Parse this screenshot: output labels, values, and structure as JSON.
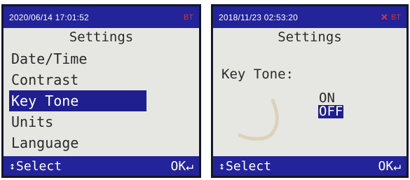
{
  "left_screen": {
    "status": {
      "datetime": "2020/06/14 17:01:52",
      "bt": "BT"
    },
    "title": "Settings",
    "menu": [
      {
        "label": "Date/Time",
        "selected": false
      },
      {
        "label": "Contrast",
        "selected": false
      },
      {
        "label": "Key Tone",
        "selected": true
      },
      {
        "label": "Units",
        "selected": false
      },
      {
        "label": "Language",
        "selected": false
      }
    ],
    "footer": {
      "arrow": "↕",
      "select": "Select",
      "ok": "OK↵"
    }
  },
  "right_screen": {
    "status": {
      "datetime": "2018/11/23 02:53:20",
      "mute": "✕",
      "bt": "BT"
    },
    "title": "Settings",
    "label": "Key Tone:",
    "options": {
      "on": "ON",
      "off": "OFF",
      "selected": "off"
    },
    "footer": {
      "arrow": "↕",
      "select": "Select",
      "ok": "OK↵"
    }
  },
  "colors": {
    "bar": "#23239a",
    "highlight": "#1f1f8f",
    "screen": "#e6e7e2",
    "alert": "#c8373a"
  }
}
